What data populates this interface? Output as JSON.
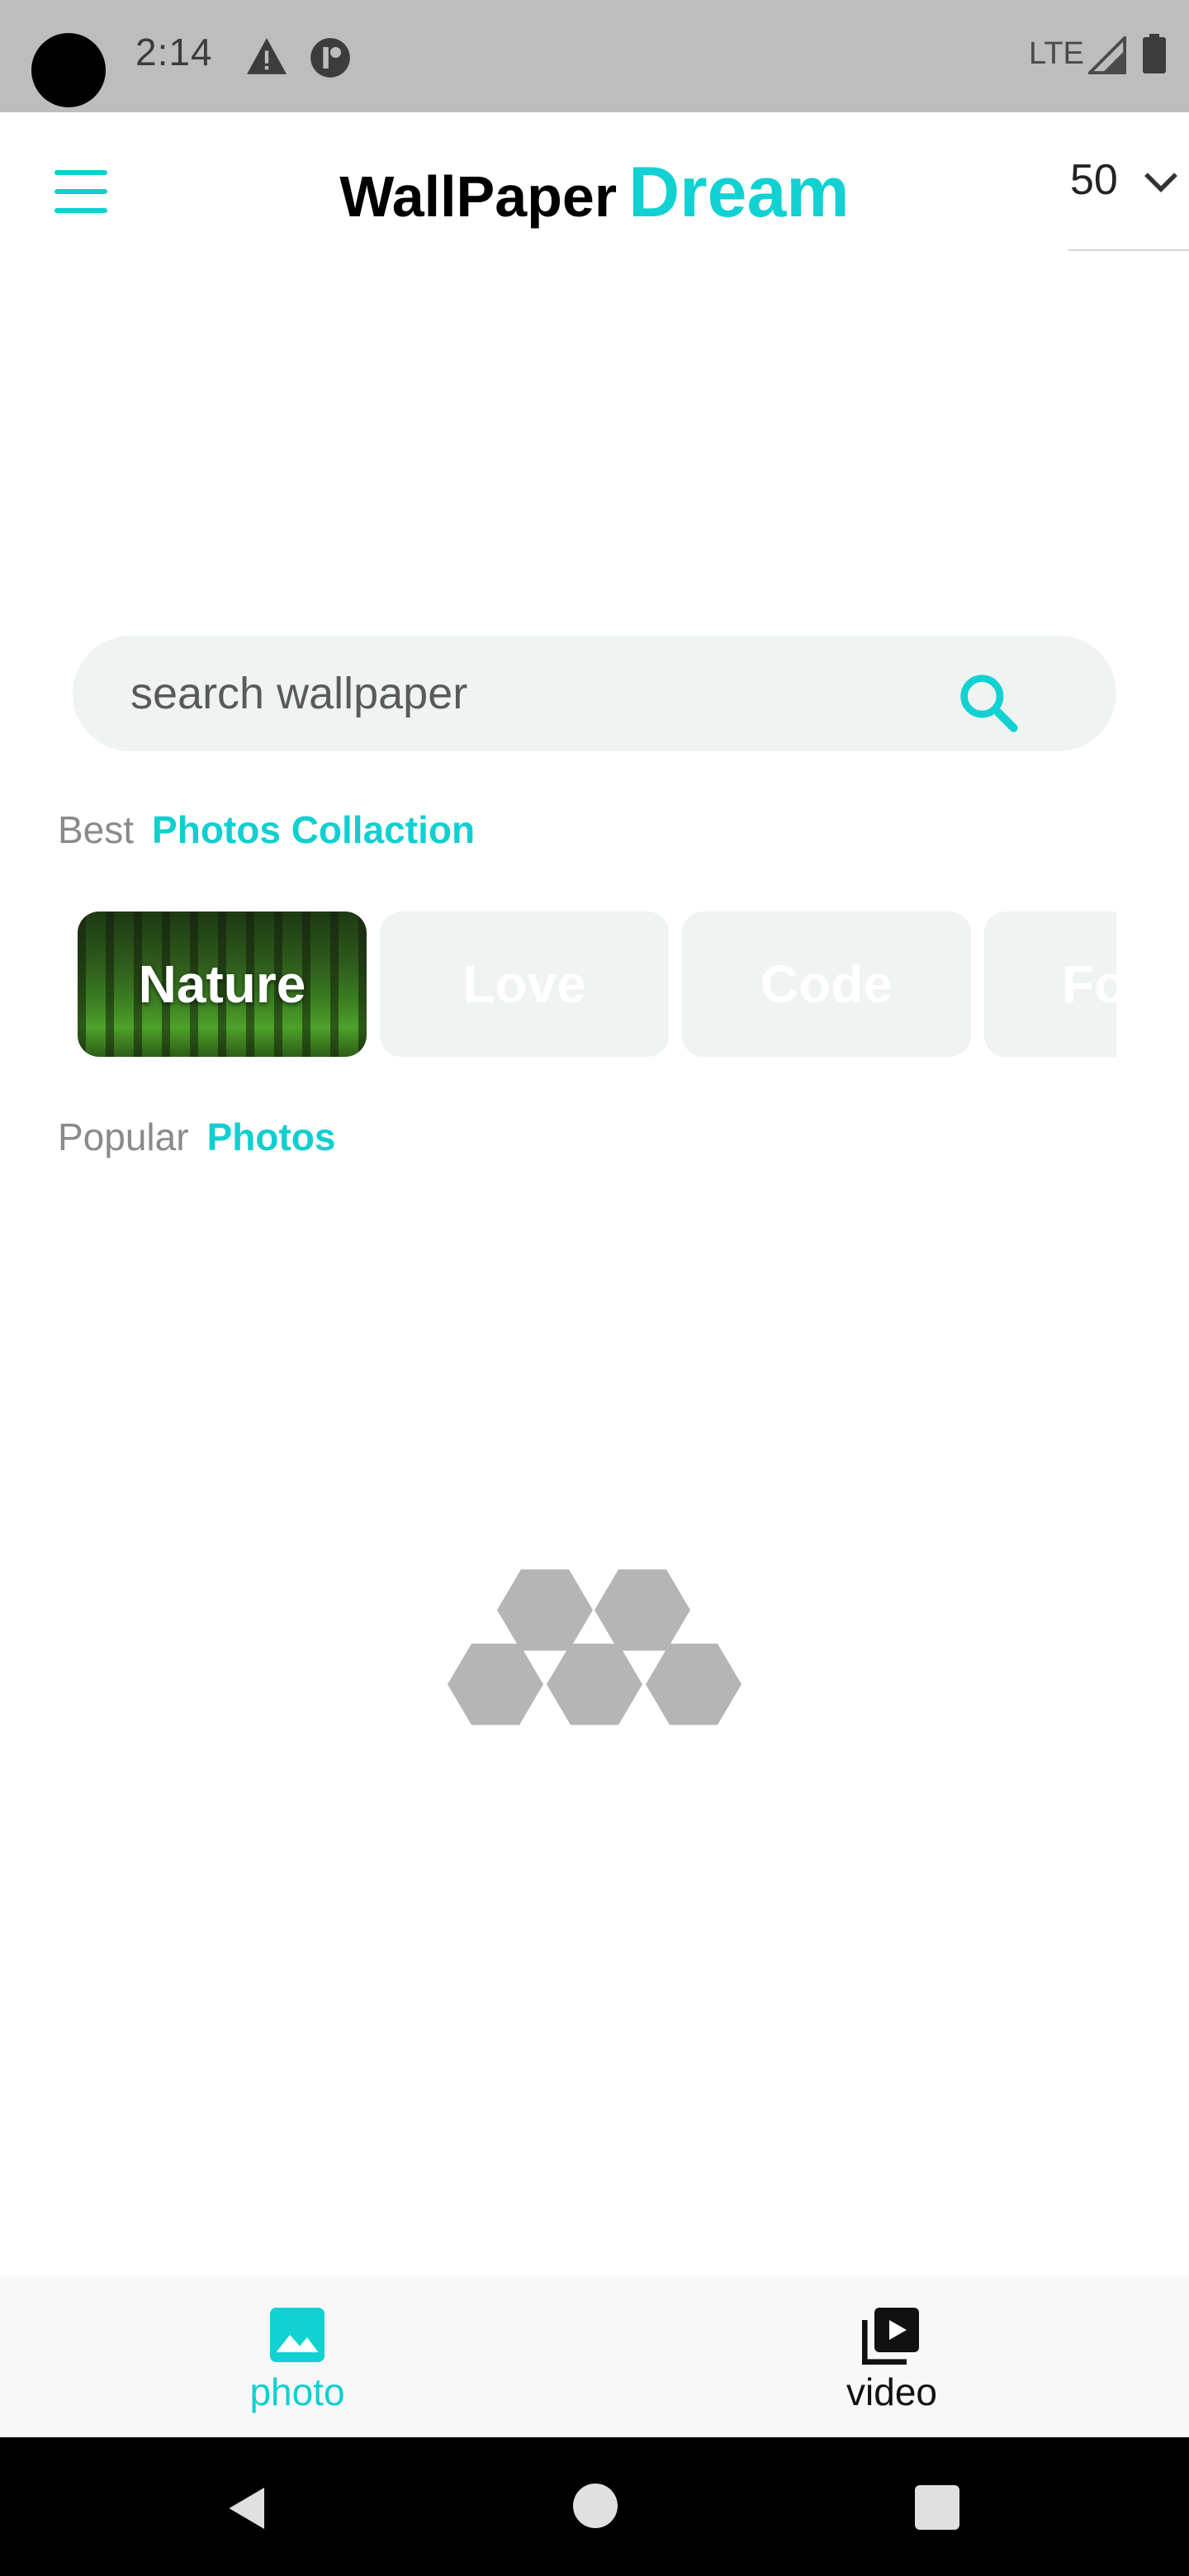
{
  "status_bar": {
    "time": "2:14",
    "network": "LTE"
  },
  "header": {
    "title_main": "WallPaper",
    "title_accent": "Dream",
    "count_selected": "50"
  },
  "search": {
    "placeholder": "search wallpaper"
  },
  "best_section": {
    "muted_label": "Best",
    "accent_label": "Photos Collaction"
  },
  "categories": [
    {
      "label": "Nature",
      "active": true
    },
    {
      "label": "Love",
      "active": false
    },
    {
      "label": "Code",
      "active": false
    },
    {
      "label": "Fo",
      "active": false
    }
  ],
  "popular_section": {
    "muted_label": "Popular",
    "accent_label": "Photos"
  },
  "bottom_nav": {
    "photo_label": "photo",
    "video_label": "video"
  },
  "colors": {
    "accent": "#12d1d2",
    "loader": "#b5b5b5",
    "chip_background": "#eff3f2"
  },
  "icons": {
    "menu": "hamburger-menu-icon",
    "search": "search-icon",
    "photo": "image-icon",
    "video": "video-library-icon"
  }
}
